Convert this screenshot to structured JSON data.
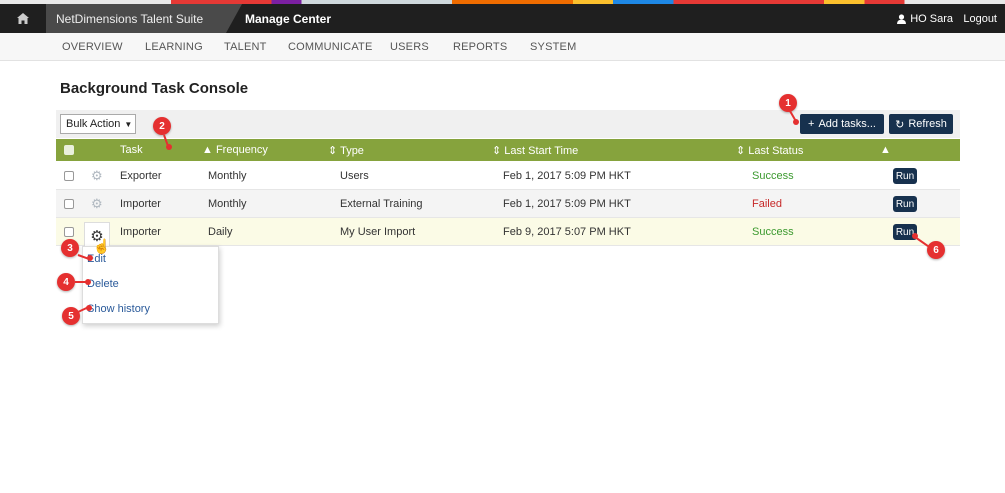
{
  "topbar": {
    "suite_name": "NetDimensions Talent Suite",
    "section": "Manage Center",
    "user": "HO Sara",
    "logout": "Logout"
  },
  "nav": {
    "items": [
      "OVERVIEW",
      "LEARNING",
      "TALENT",
      "COMMUNICATE",
      "USERS",
      "REPORTS",
      "SYSTEM"
    ]
  },
  "page_title": "Background Task Console",
  "toolbar": {
    "bulk_action": "Bulk Action",
    "add_tasks": "Add tasks...",
    "refresh": "Refresh"
  },
  "table": {
    "headers": {
      "task": "Task",
      "frequency": "Frequency",
      "type": "Type",
      "last_start": "Last Start Time",
      "last_status": "Last Status"
    },
    "rows": [
      {
        "task": "Exporter",
        "frequency": "Monthly",
        "type": "Users",
        "last_start": "Feb 1, 2017 5:09 PM HKT",
        "status": "Success",
        "run": "Run"
      },
      {
        "task": "Importer",
        "frequency": "Monthly",
        "type": "External Training",
        "last_start": "Feb 1, 2017 5:09 PM HKT",
        "status": "Failed",
        "run": "Run"
      },
      {
        "task": "Importer",
        "frequency": "Daily",
        "type": "My User Import",
        "last_start": "Feb 9, 2017 5:07 PM HKT",
        "status": "Success",
        "run": "Run"
      }
    ]
  },
  "menu": {
    "edit": "Edit",
    "delete": "Delete",
    "show_history": "Show history"
  },
  "callouts": [
    "1",
    "2",
    "3",
    "4",
    "5",
    "6"
  ],
  "colors": {
    "header_green": "#86a33d",
    "button_navy": "#17314e",
    "success": "#3c9a2f",
    "failed": "#c62828",
    "callout_red": "#e53030"
  }
}
